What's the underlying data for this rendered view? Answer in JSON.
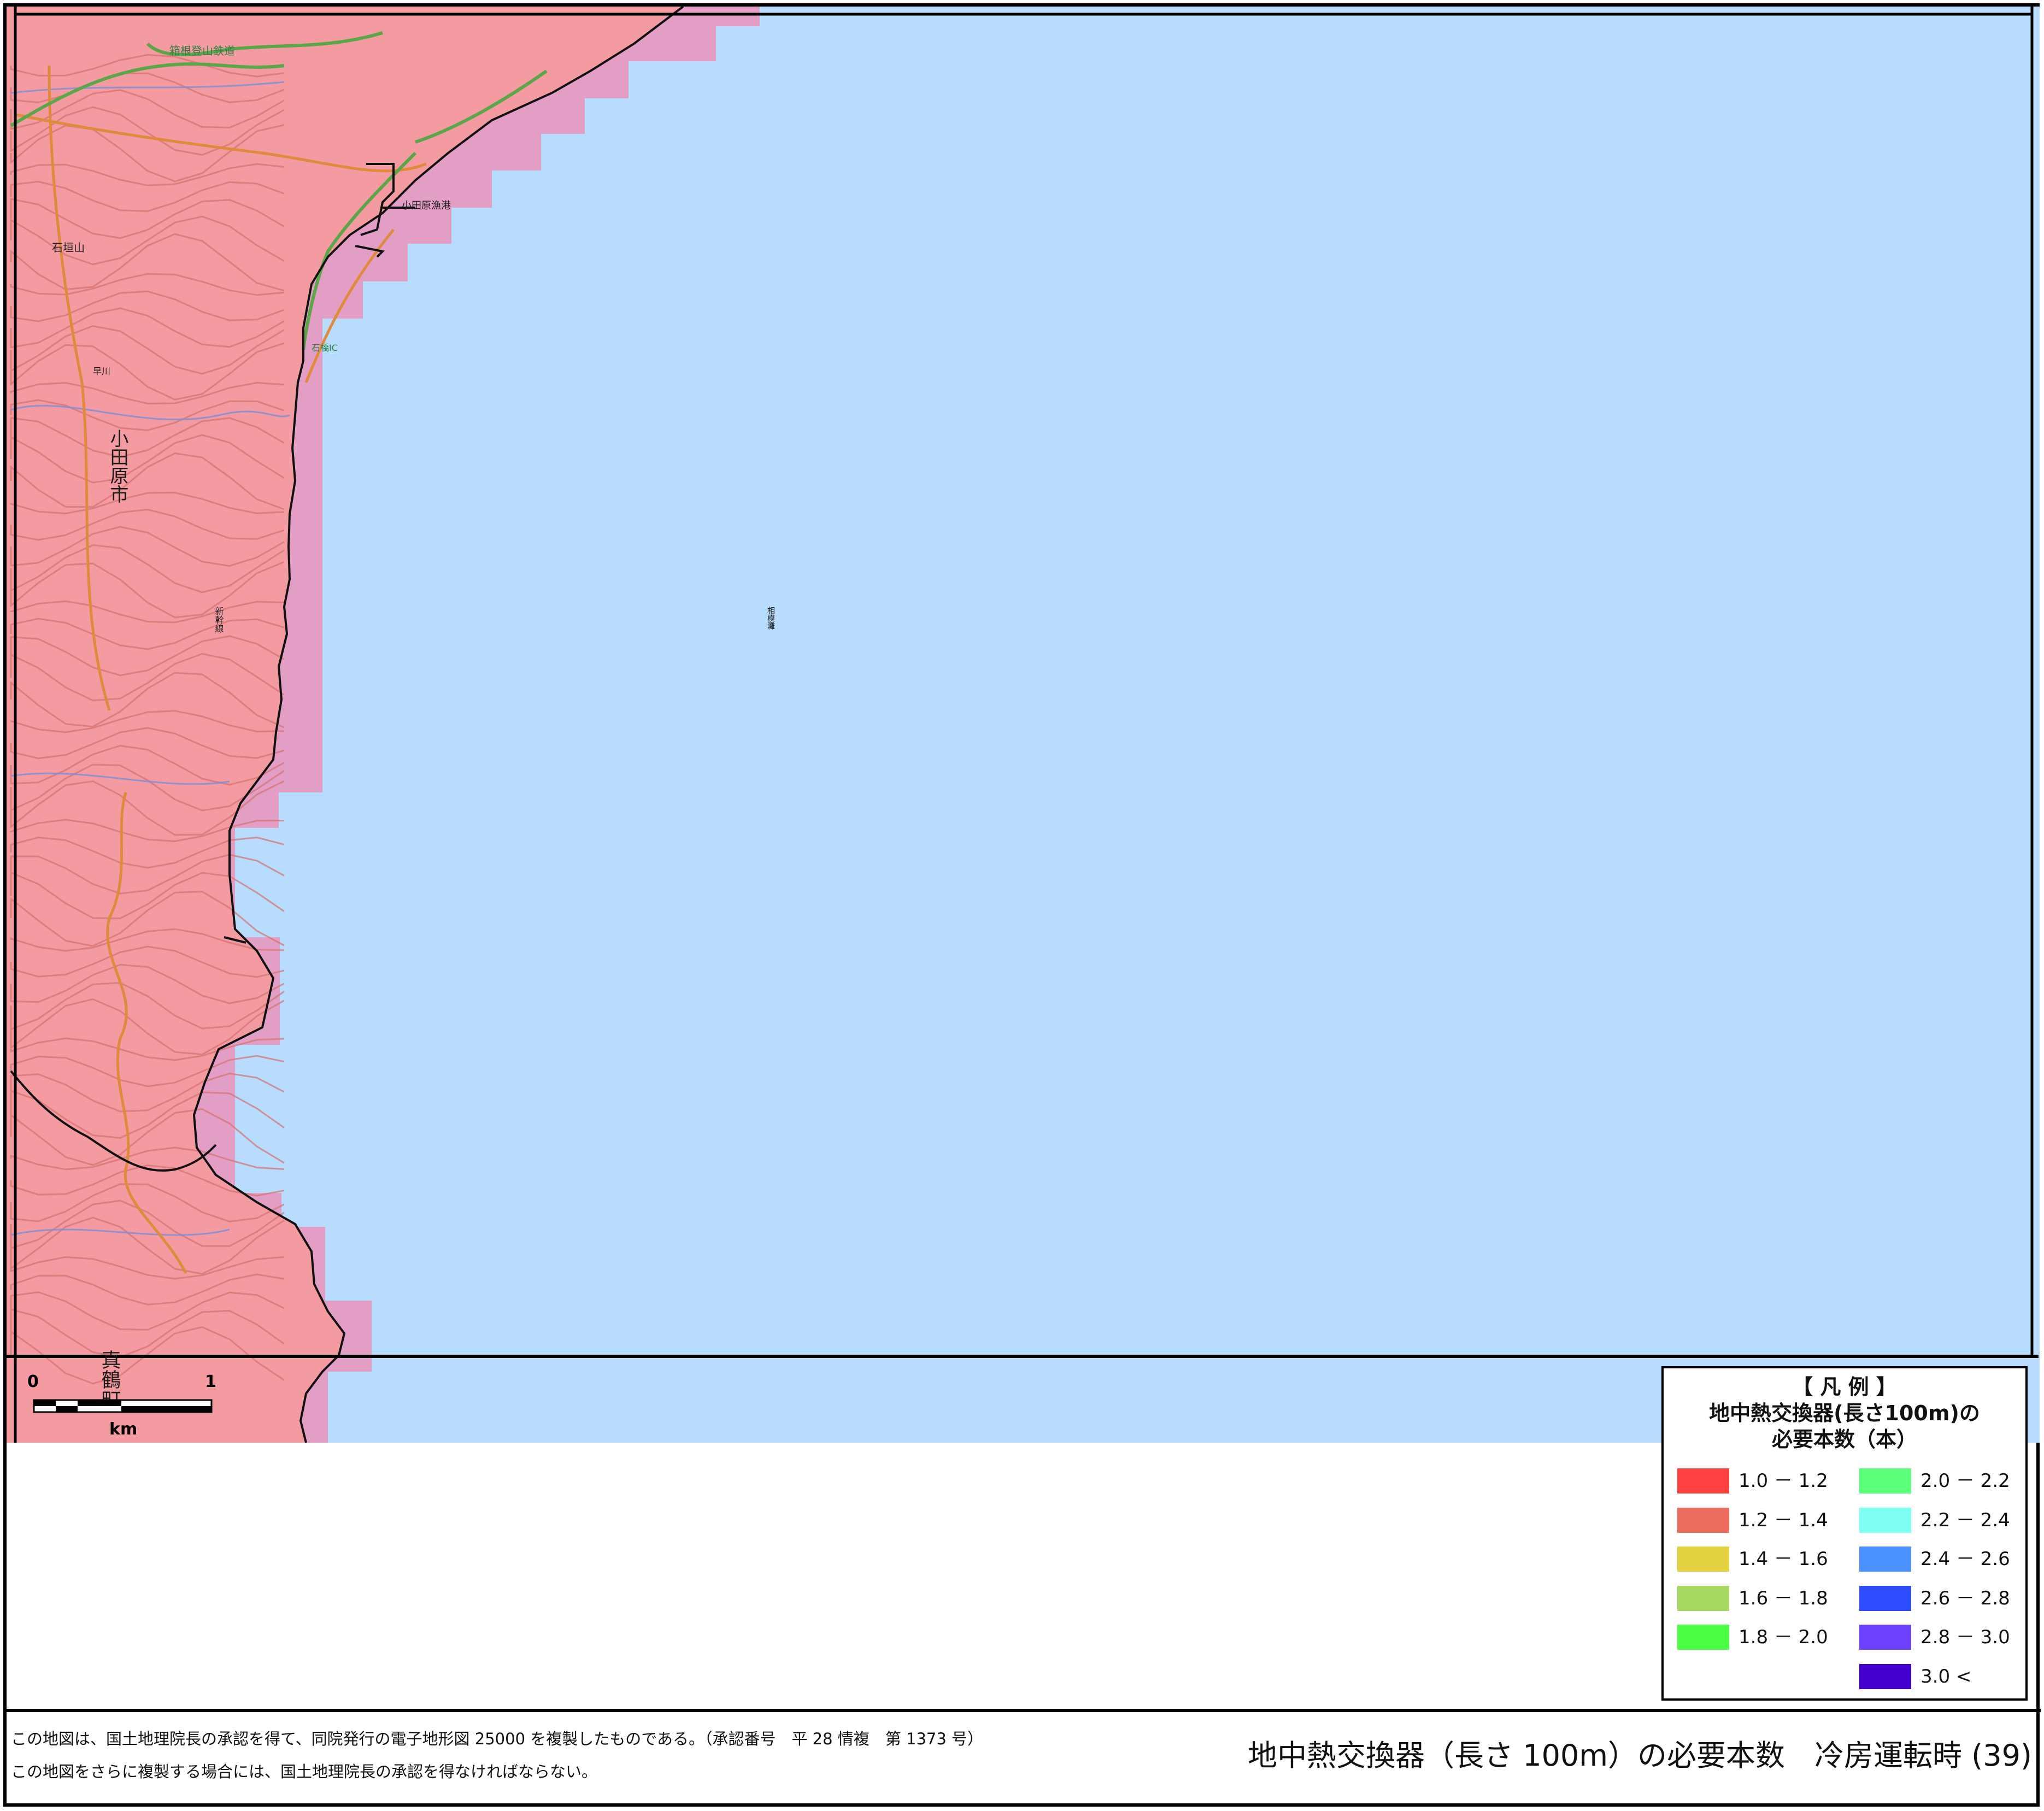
{
  "map": {
    "labels": {
      "city_odawara": "小田原市",
      "town_manazuru": "真鶴町",
      "mountain_ishigaki": "石垣山",
      "sea_sagami": "相模灘",
      "railway_hakone": "箱根登山鉄道",
      "port_odawara": "小田原漁港",
      "ic_ishibashi": "石橋IC",
      "river_hayakawa": "早川",
      "shinkansen": "新幹線"
    },
    "colors": {
      "land": "#f49aa1",
      "sea": "#b7dcfd",
      "coast_cells": "#e39ec6",
      "contours": "#d4736f",
      "roads": "#e08a3c",
      "road_green": "#5ca64a",
      "boundary": "#111111"
    },
    "scale_bar": {
      "start": "0",
      "end": "1",
      "unit": "km"
    }
  },
  "legend": {
    "header": "【 凡 例 】",
    "title_line1": "地中熱交換器(長さ100m)の",
    "title_line2": "必要本数（本）",
    "items": [
      {
        "label": "1.0 － 1.2",
        "color": "#ff4040"
      },
      {
        "label": "1.2 － 1.4",
        "color": "#ec6c5e"
      },
      {
        "label": "1.4 － 1.6",
        "color": "#e5d240"
      },
      {
        "label": "1.6 － 1.8",
        "color": "#a6d862"
      },
      {
        "label": "1.8 － 2.0",
        "color": "#4dff44"
      },
      {
        "label": "2.0 － 2.2",
        "color": "#5cff78"
      },
      {
        "label": "2.2 － 2.4",
        "color": "#7efff2"
      },
      {
        "label": "2.4 － 2.6",
        "color": "#4a90ff"
      },
      {
        "label": "2.6 － 2.8",
        "color": "#2e4dff"
      },
      {
        "label": "2.8 － 3.0",
        "color": "#6e40ff"
      },
      {
        "label": "3.0 <",
        "color": "#4400cc"
      }
    ]
  },
  "footer": {
    "note_line1": "この地図は、国土地理院長の承認を得て、同院発行の電子地形図 25000 を複製したものである。（承認番号　平 28 情複　第 1373 号）",
    "note_line2": "この地図をさらに複製する場合には、国土地理院長の承認を得なければならない。",
    "title": "地中熱交換器（長さ 100m）の必要本数　冷房運転時 (39)"
  }
}
